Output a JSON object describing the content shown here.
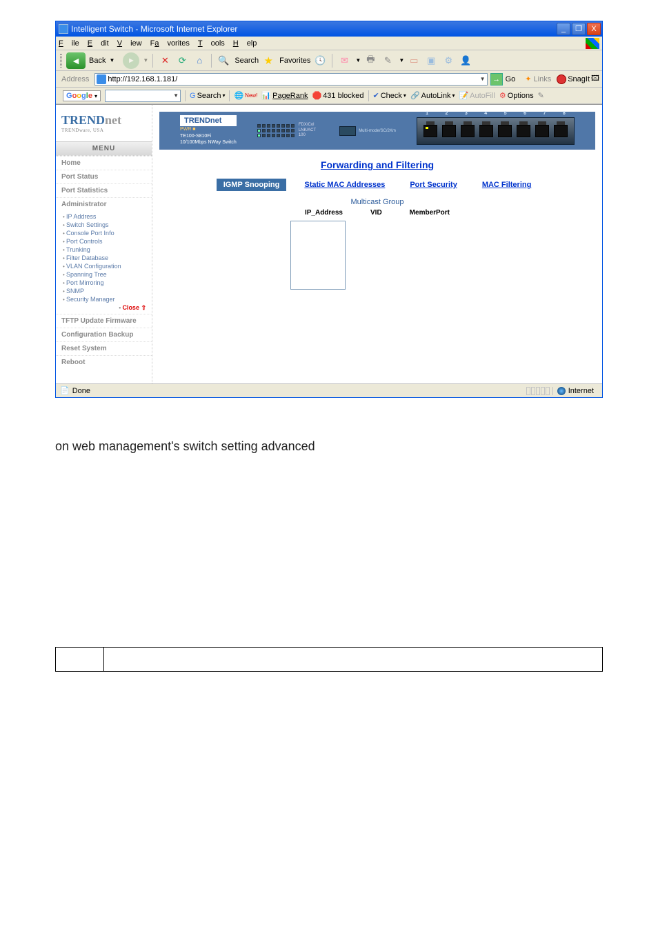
{
  "window": {
    "title": "Intelligent Switch - Microsoft Internet Explorer",
    "min": "_",
    "max": "❐",
    "close": "X"
  },
  "menus": {
    "file": "File",
    "edit": "Edit",
    "view": "View",
    "favorites": "Favorites",
    "tools": "Tools",
    "help": "Help"
  },
  "toolbar": {
    "back": "Back",
    "search": "Search",
    "favorites": "Favorites"
  },
  "address": {
    "label": "Address",
    "url": "http://192.168.1.181/",
    "go": "Go",
    "links": "Links",
    "snagit": "SnagIt"
  },
  "google": {
    "logo": "Google",
    "searchBtn": "Search",
    "new": "New!",
    "pagerank": "PageRank",
    "blocked": "431 blocked",
    "check": "Check",
    "autolink": "AutoLink",
    "autofill": "AutoFill",
    "options": "Options"
  },
  "sidebar": {
    "brand1": "TREND",
    "brand2": "net",
    "tag": "TRENDware, USA",
    "menu": "MENU",
    "home": "Home",
    "portStatus": "Port Status",
    "portStats": "Port Statistics",
    "admin": "Administrator",
    "sub": {
      "ip": "IP Address",
      "switch": "Switch Settings",
      "console": "Console Port Info",
      "port": "Port Controls",
      "trunk": "Trunking",
      "filter": "Filter Database",
      "vlan": "VLAN Configuration",
      "span": "Spanning Tree",
      "mirror": "Port Mirroring",
      "snmp": "SNMP",
      "sec": "Security Manager"
    },
    "close": "Close ⇧",
    "tftp": "TFTP Update Firmware",
    "config": "Configuration Backup",
    "reset": "Reset System",
    "reboot": "Reboot"
  },
  "banner": {
    "brand": "TRENDnet",
    "model1": "TE100-S810Fi",
    "model2": "10/100Mbps NWay Switch",
    "led1": "FDX/Col",
    "led2": "LNK/ACT",
    "led3": "100",
    "pwr": "PWR",
    "sfp": "Multi-mode/SC/2Km",
    "ports": [
      "1",
      "2",
      "3",
      "4",
      "5",
      "6",
      "7",
      "8"
    ]
  },
  "main": {
    "title": "Forwarding and Filtering",
    "tab1": "IGMP Snooping",
    "tab2": "Static MAC Addresses",
    "tab3": "Port Security",
    "tab4": "MAC Filtering",
    "mcTitle": "Multicast Group",
    "col1": "IP_Address",
    "col2": "VID",
    "col3": "MemberPort"
  },
  "status": {
    "done": "Done",
    "zone": "Internet"
  },
  "caption": "on web management's switch setting advanced"
}
